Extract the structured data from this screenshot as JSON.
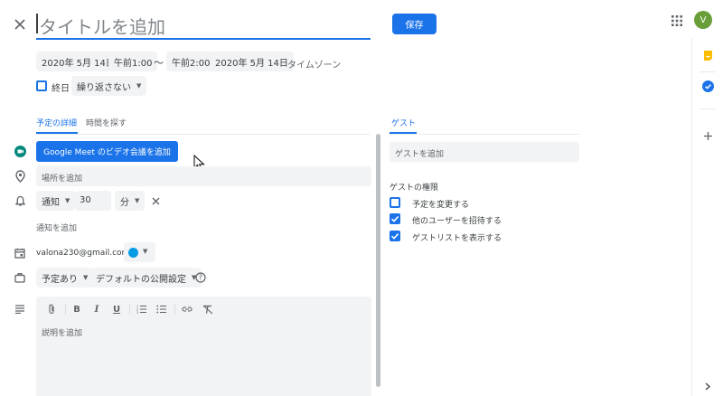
{
  "header": {
    "title_placeholder": "タイトルを追加",
    "save_label": "保存",
    "avatar_letter": "V"
  },
  "datetime": {
    "start_date": "2020年 5月 14日",
    "start_time": "午前1:00",
    "separator": "〜",
    "end_time": "午前2:00",
    "end_date": "2020年 5月 14日",
    "timezone": "タイムゾーン",
    "all_day": "終日",
    "repeat": "繰り返さない"
  },
  "tabs": {
    "details": "予定の詳細",
    "find_time": "時間を探す",
    "guests": "ゲスト"
  },
  "details": {
    "meet_button": "Google Meet のビデオ会議を追加",
    "location_placeholder": "場所を追加",
    "notify_type": "通知",
    "notify_value": "30",
    "notify_unit": "分",
    "add_notification": "通知を追加",
    "calendar_owner": "valona230@gmail.com",
    "availability": "予定あり",
    "visibility": "デフォルトの公開設定",
    "description_placeholder": "説明を追加"
  },
  "guests": {
    "add_placeholder": "ゲストを追加",
    "permissions_title": "ゲストの権限",
    "permissions": [
      {
        "label": "予定を変更する",
        "checked": false
      },
      {
        "label": "他のユーザーを招待する",
        "checked": true
      },
      {
        "label": "ゲストリストを表示する",
        "checked": true
      }
    ]
  },
  "colors": {
    "accent": "#1a73e8",
    "meet_green": "#00897b",
    "avatar_green": "#689f38",
    "calendar_color": "#039be5",
    "keep_yellow": "#fbbc04"
  },
  "icons": [
    "close-icon",
    "apps-grid-icon",
    "meet-icon",
    "location-icon",
    "bell-icon",
    "calendar-icon",
    "briefcase-icon",
    "description-icon",
    "attach-icon",
    "bold-icon",
    "italic-icon",
    "underline-icon",
    "numbered-list-icon",
    "bullet-list-icon",
    "link-icon",
    "clear-format-icon",
    "help-icon",
    "keep-icon",
    "tasks-icon",
    "plus-icon",
    "chevron-right-icon"
  ]
}
